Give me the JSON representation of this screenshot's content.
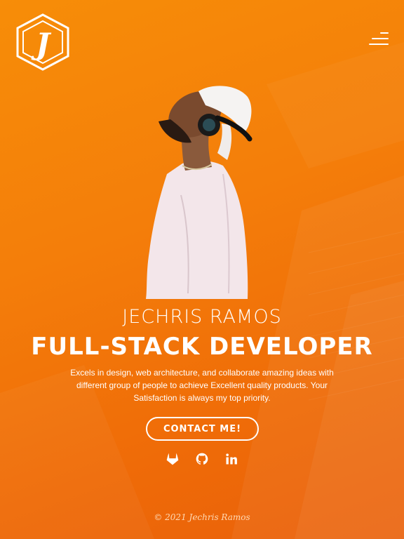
{
  "header": {
    "logo_letter": "J",
    "menu_icon": "hamburger-menu-icon"
  },
  "hero": {
    "name": "JECHRIS RAMOS",
    "title": "FULL-STACK DEVELOPER",
    "description": "Excels in design, web architecture, and collaborate amazing ideas with different group of people to achieve Excellent quality products. Your Satisfaction is always my top priority.",
    "cta_label": "CONTACT ME!"
  },
  "socials": [
    {
      "icon": "gitlab-icon"
    },
    {
      "icon": "github-icon"
    },
    {
      "icon": "linkedin-icon"
    }
  ],
  "footer": {
    "copyright": "© 2021 Jechris Ramos"
  },
  "colors": {
    "accent": "#f47e0a",
    "text": "#ffffff"
  }
}
